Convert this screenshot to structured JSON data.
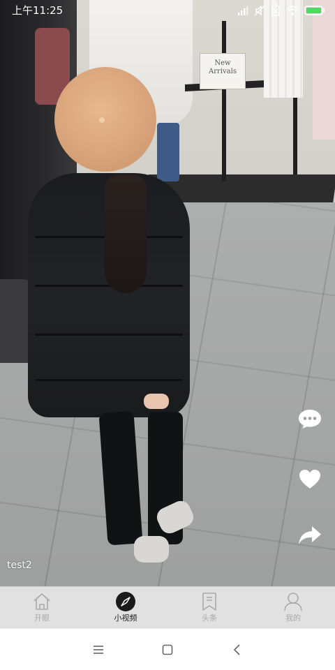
{
  "status_bar": {
    "time": "上午11:25",
    "icons": [
      "signal-icon",
      "mute-icon",
      "sim-icon",
      "wifi-icon",
      "battery-icon"
    ]
  },
  "video": {
    "caption": "test2",
    "sign_text": "New Arrivals"
  },
  "actions": [
    {
      "icon": "comment-icon"
    },
    {
      "icon": "like-heart-icon"
    },
    {
      "icon": "share-icon"
    }
  ],
  "tab_bar": {
    "tabs": [
      {
        "label": "开眼",
        "icon": "home-icon",
        "active": false
      },
      {
        "label": "小视频",
        "icon": "compass-icon",
        "active": true
      },
      {
        "label": "头条",
        "icon": "bookmark-icon",
        "active": false
      },
      {
        "label": "我的",
        "icon": "user-icon",
        "active": false
      }
    ]
  },
  "nav_bar": {
    "buttons": [
      "menu-icon",
      "home-square-icon",
      "back-icon"
    ]
  },
  "colors": {
    "tab_bar_bg": "#e1e1e1",
    "tab_inactive": "#a9a9a9",
    "tab_active": "#1a1a1a"
  }
}
